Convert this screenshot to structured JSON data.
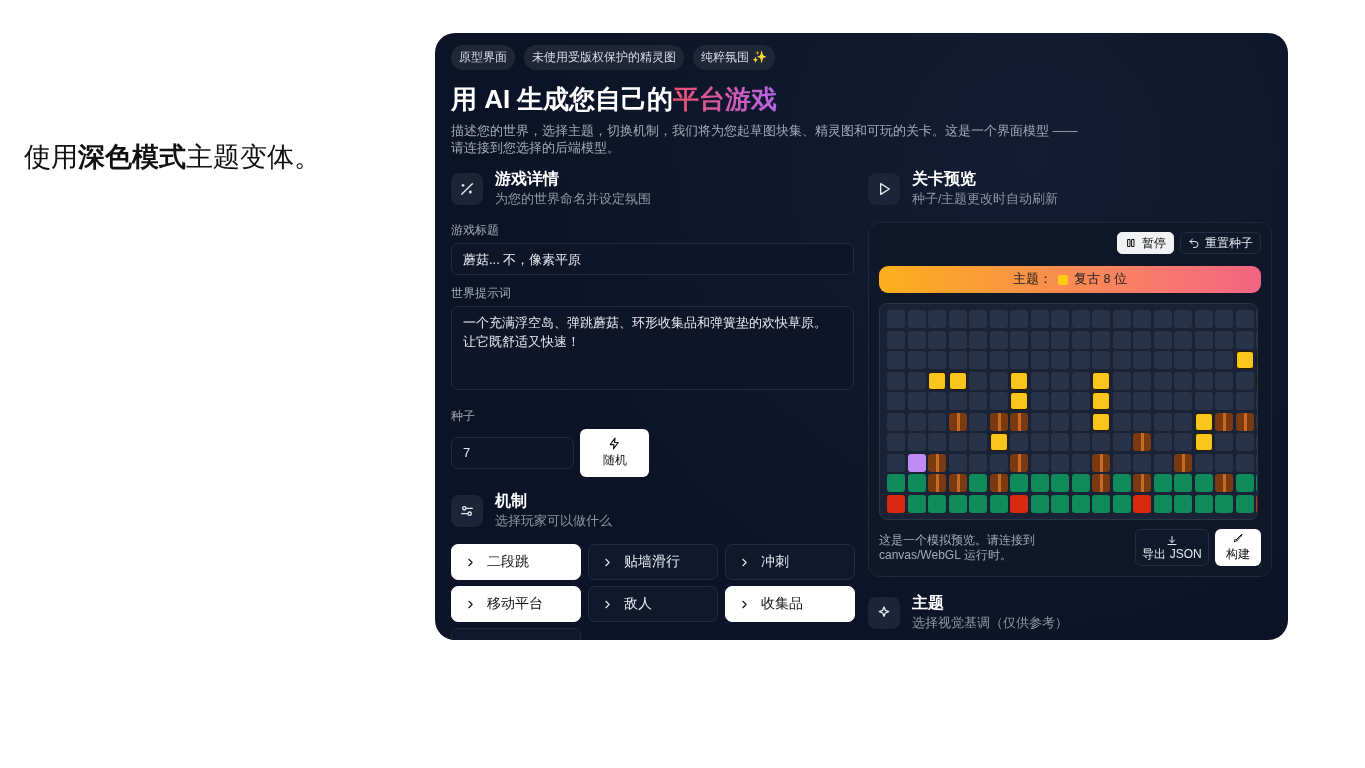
{
  "caption": "使用**深色模式**主题变体。",
  "tags": [
    "原型界面",
    "未使用受版权保护的精灵图",
    "纯粹氛围 ✨"
  ],
  "title": "用 AI 生成您自己的",
  "title_highlight": "平台游戏",
  "subtitle": "描述您的世界，选择主题，切换机制，我们将为您起草图块集、精灵图和可玩的关卡。这是一个界面模型 —— 请连接到您选择的后端模型。",
  "game_details": {
    "title": "游戏详情",
    "subtitle": "为您的世界命名并设定氛围",
    "game_title": {
      "label": "游戏标题",
      "value": "蘑菇... 不，像素平原"
    },
    "world_prompt": {
      "label": "世界提示词",
      "value": "一个充满浮空岛、弹跳蘑菇、环形收集品和弹簧垫的欢快草原。让它既舒适又快速！"
    },
    "seed": {
      "label": "种子",
      "value": "7",
      "button": "随机"
    }
  },
  "mechanics": {
    "title": "机制",
    "subtitle": "选择玩家可以做什么",
    "items": [
      {
        "kind": "chip",
        "label": "二段跳",
        "selected": true
      },
      {
        "kind": "chip",
        "label": "贴墙滑行",
        "selected": false
      },
      {
        "kind": "chip",
        "label": "冲刺",
        "selected": false
      },
      {
        "kind": "chip",
        "label": "移动平台",
        "selected": true
      },
      {
        "kind": "chip",
        "label": "敌人",
        "selected": false
      },
      {
        "kind": "chip",
        "label": "收集品",
        "selected": true
      },
      {
        "kind": "cut",
        "selected": false
      }
    ]
  },
  "preview": {
    "title": "关卡预览",
    "subtitle": "种子/主题更改时自动刷新",
    "pause_button": "暂停",
    "reset_button": "重置种子",
    "theme_label": "主题：",
    "theme_name": "复古 8 位",
    "note": "这是一个模拟预览。请连接到 canvas/WebGL 运行时。",
    "export_button": "导出 JSON",
    "build_button": "构建"
  },
  "theme_section": {
    "title": "主题",
    "subtitle": "选择视觉基调（仅供参考）"
  }
}
